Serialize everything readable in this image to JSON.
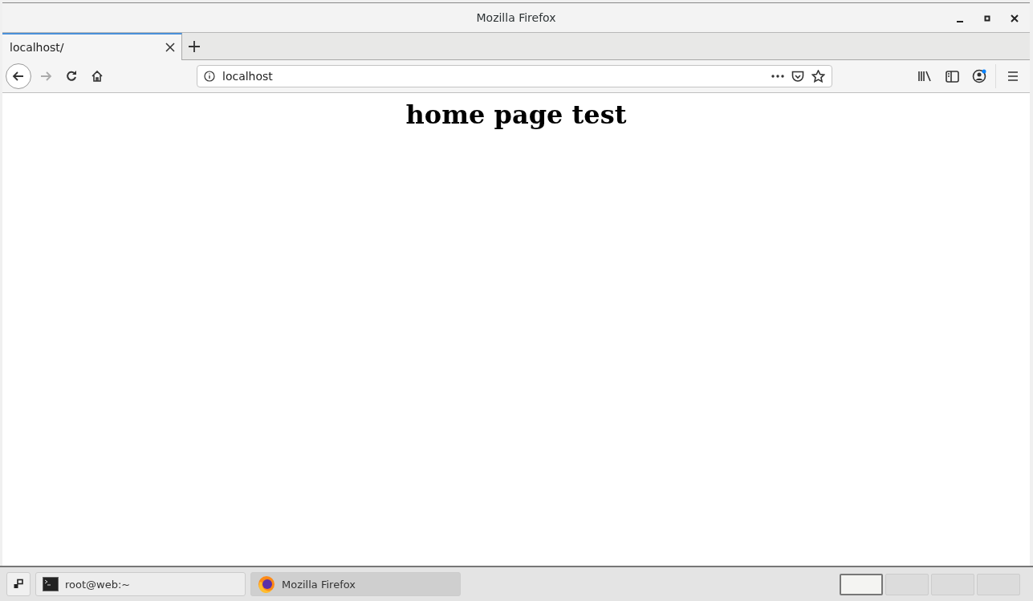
{
  "window": {
    "title": "Mozilla Firefox"
  },
  "tabs": [
    {
      "label": "localhost/",
      "selected": true
    }
  ],
  "nav_buttons": [
    {
      "kind": "back",
      "disabled": false
    },
    {
      "kind": "forward",
      "disabled": true
    },
    {
      "kind": "reload",
      "disabled": false
    },
    {
      "kind": "home",
      "disabled": false
    }
  ],
  "address_bar": {
    "value": "localhost"
  },
  "account": {
    "notification": true
  },
  "page": {
    "heading": "home page test"
  },
  "taskbar": {
    "items": [
      {
        "label": "root@web:~",
        "kind": "terminal",
        "selected": false
      },
      {
        "label": "Mozilla Firefox",
        "kind": "browser",
        "selected": true
      }
    ],
    "workspaces": [
      {
        "selected": true
      },
      {
        "selected": false
      },
      {
        "selected": false
      },
      {
        "selected": false
      }
    ]
  }
}
